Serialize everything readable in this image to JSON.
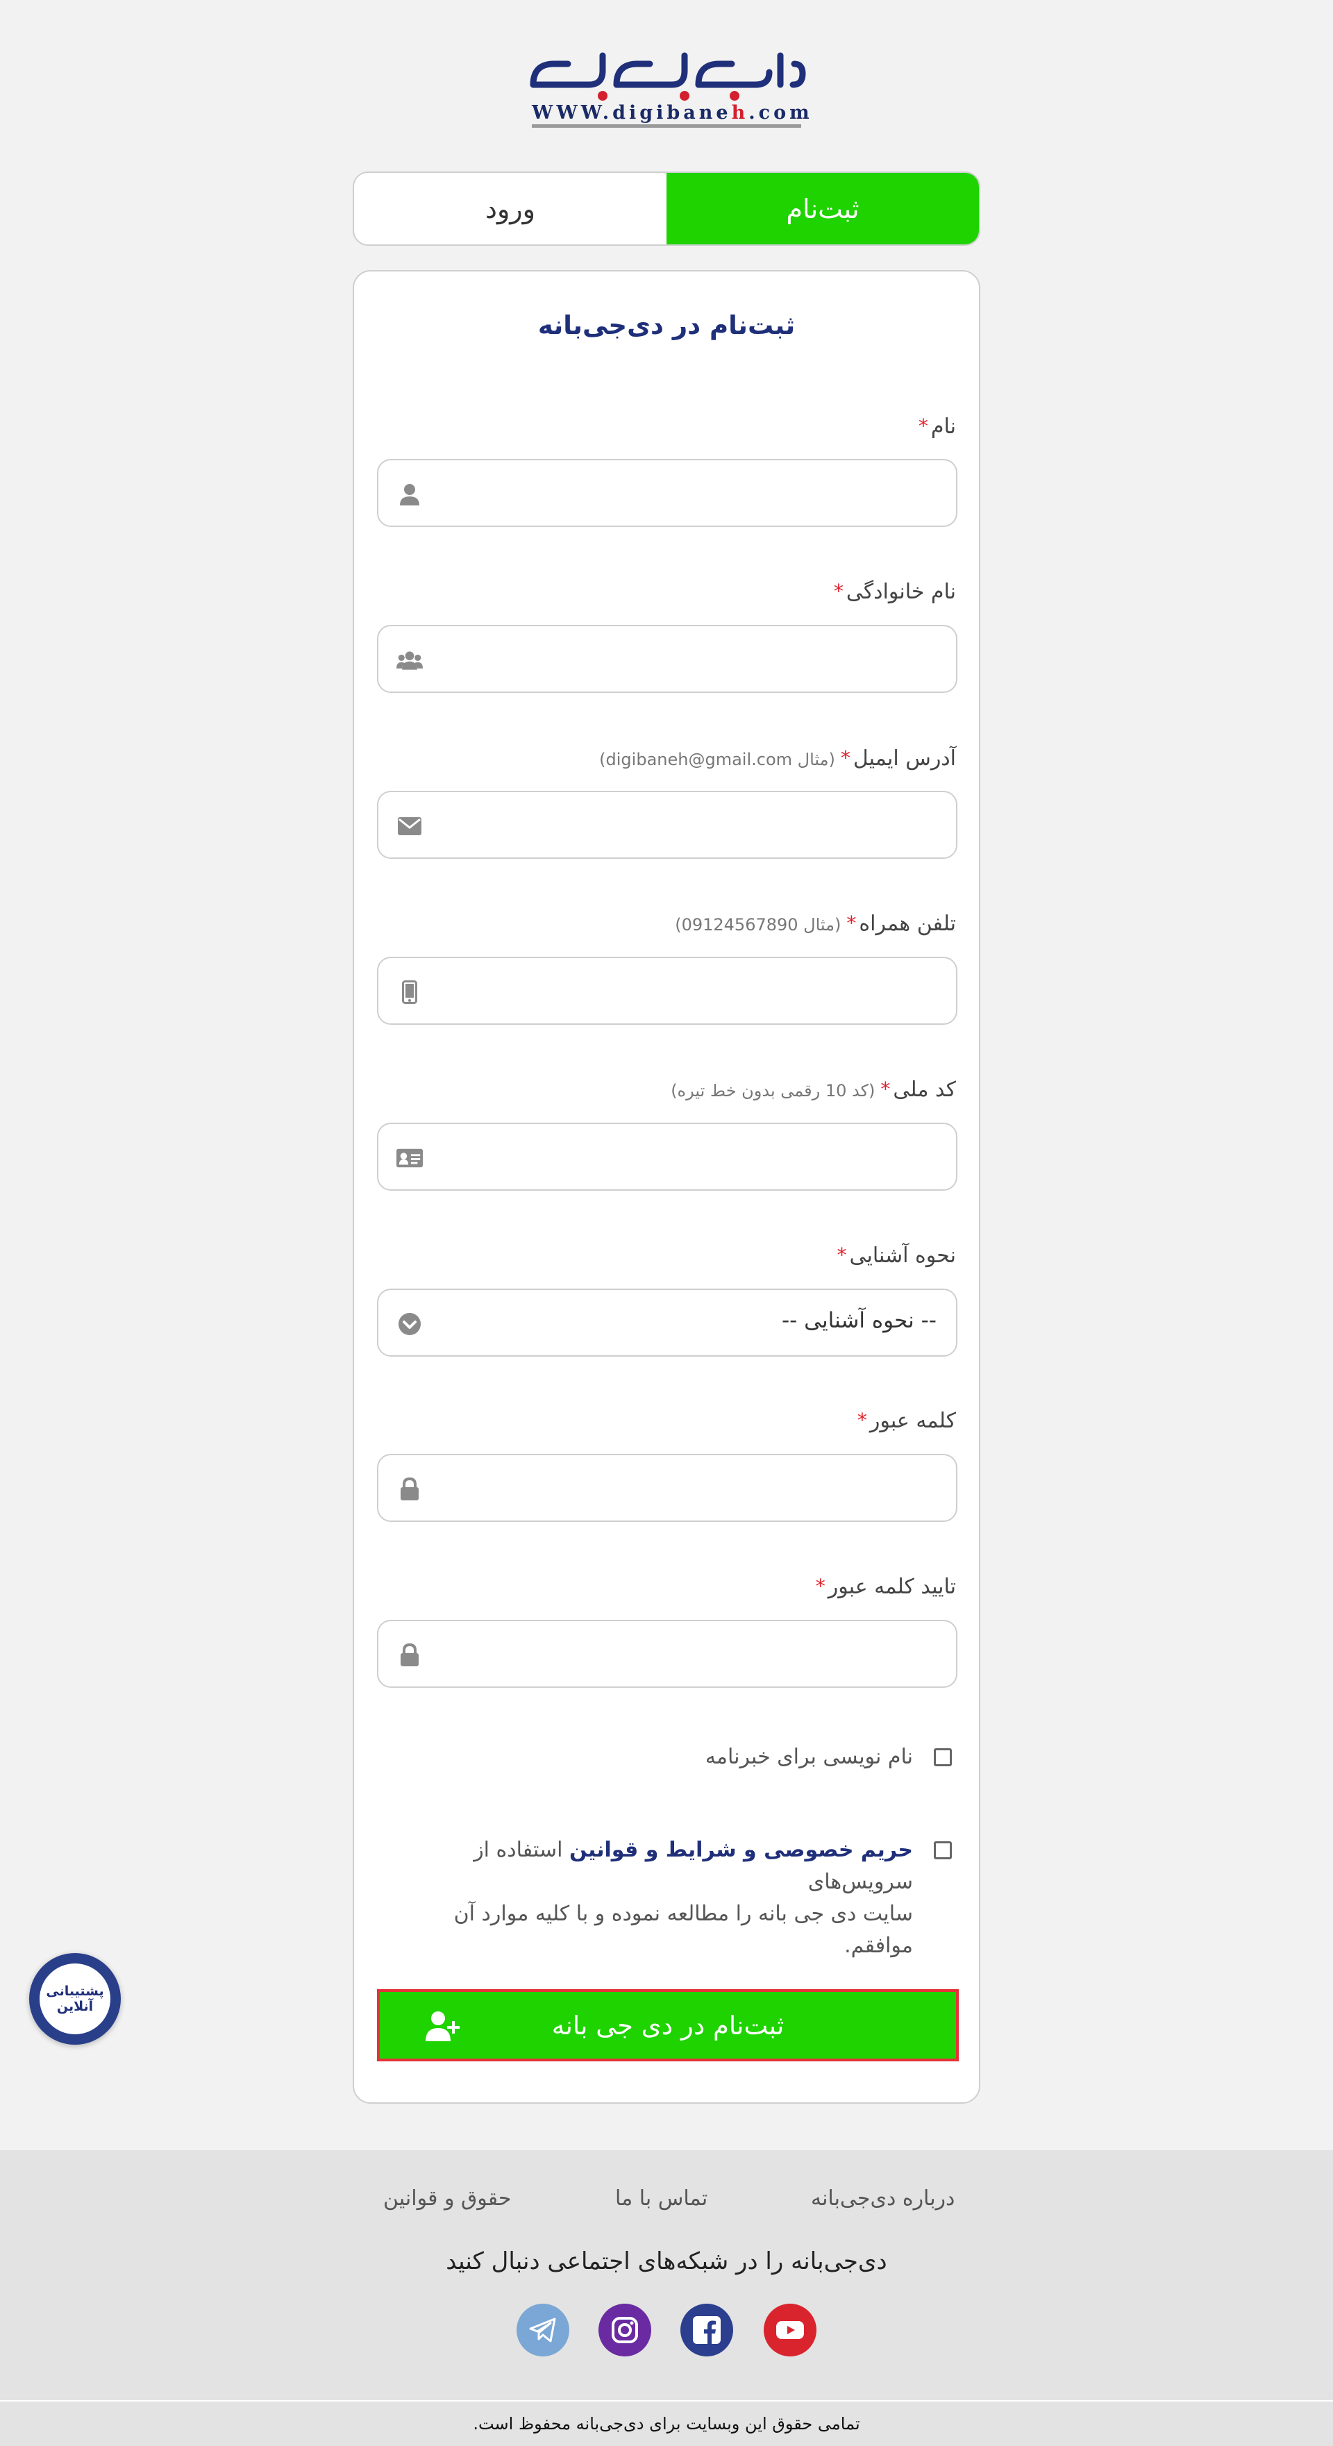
{
  "logo": {
    "brand_text": "دی‌جی‌بانه",
    "url_prefix": "WWW.digibane",
    "url_red": "h",
    "url_suffix": ".com"
  },
  "tabs": {
    "login": "ورود",
    "register": "ثبت‌نام"
  },
  "form": {
    "title": "ثبت‌نام در دی‌جی‌بانه",
    "required_mark": "*",
    "fields": {
      "first_name": {
        "label": "نام",
        "hint": "",
        "icon": "user-icon"
      },
      "last_name": {
        "label": "نام خانوادگی",
        "hint": "",
        "icon": "users-icon"
      },
      "email": {
        "label": "آدرس ایمیل",
        "hint": "(مثال digibaneh@gmail.com)",
        "icon": "envelope-icon"
      },
      "mobile": {
        "label": "تلفن همراه",
        "hint": "(مثال 09124567890)",
        "icon": "mobile-icon"
      },
      "national_code": {
        "label": "کد ملی",
        "hint": "(کد 10 رقمی بدون خط تیره)",
        "icon": "id-card-icon"
      },
      "referral": {
        "label": "نحوه آشنایی",
        "selected": "-- نحوه آشنایی --",
        "icon": "chevron-down-circle-icon"
      },
      "password": {
        "label": "کلمه عبور",
        "hint": "",
        "icon": "lock-icon"
      },
      "password_confirm": {
        "label": "تایید کلمه عبور",
        "hint": "",
        "icon": "lock-icon"
      }
    },
    "newsletter_label": "نام نویسی برای خبرنامه",
    "terms": {
      "link_text": "حریم خصوصی و شرایط و قوانین",
      "line1_rest": " استفاده از سرویس‌های",
      "line2": "سایت دی جی بانه را مطالعه نموده و با کلیه موارد آن موافقم."
    },
    "submit_label": "ثبت‌نام در دی جی بانه"
  },
  "support": {
    "line1": "پشتیبانی",
    "line2": "آنلاین"
  },
  "footer": {
    "links": {
      "about": "درباره دی‌جی‌بانه",
      "contact": "تماس با ما",
      "rights": "حقوق و قوانین"
    },
    "follow_text": "دی‌جی‌بانه را در شبکه‌های اجتماعی دنبال کنید",
    "copyright": "تمامی حقوق این وبسایت برای دی‌جی‌بانه محفوظ است."
  },
  "colors": {
    "accent_green": "#1ed300",
    "brand_navy": "#1f2f7a",
    "required_red": "#e0202b",
    "youtube": "#d9232d",
    "facebook": "#2b3f8e",
    "instagram": "#6a2aa2",
    "telegram": "#7aa7d6"
  }
}
